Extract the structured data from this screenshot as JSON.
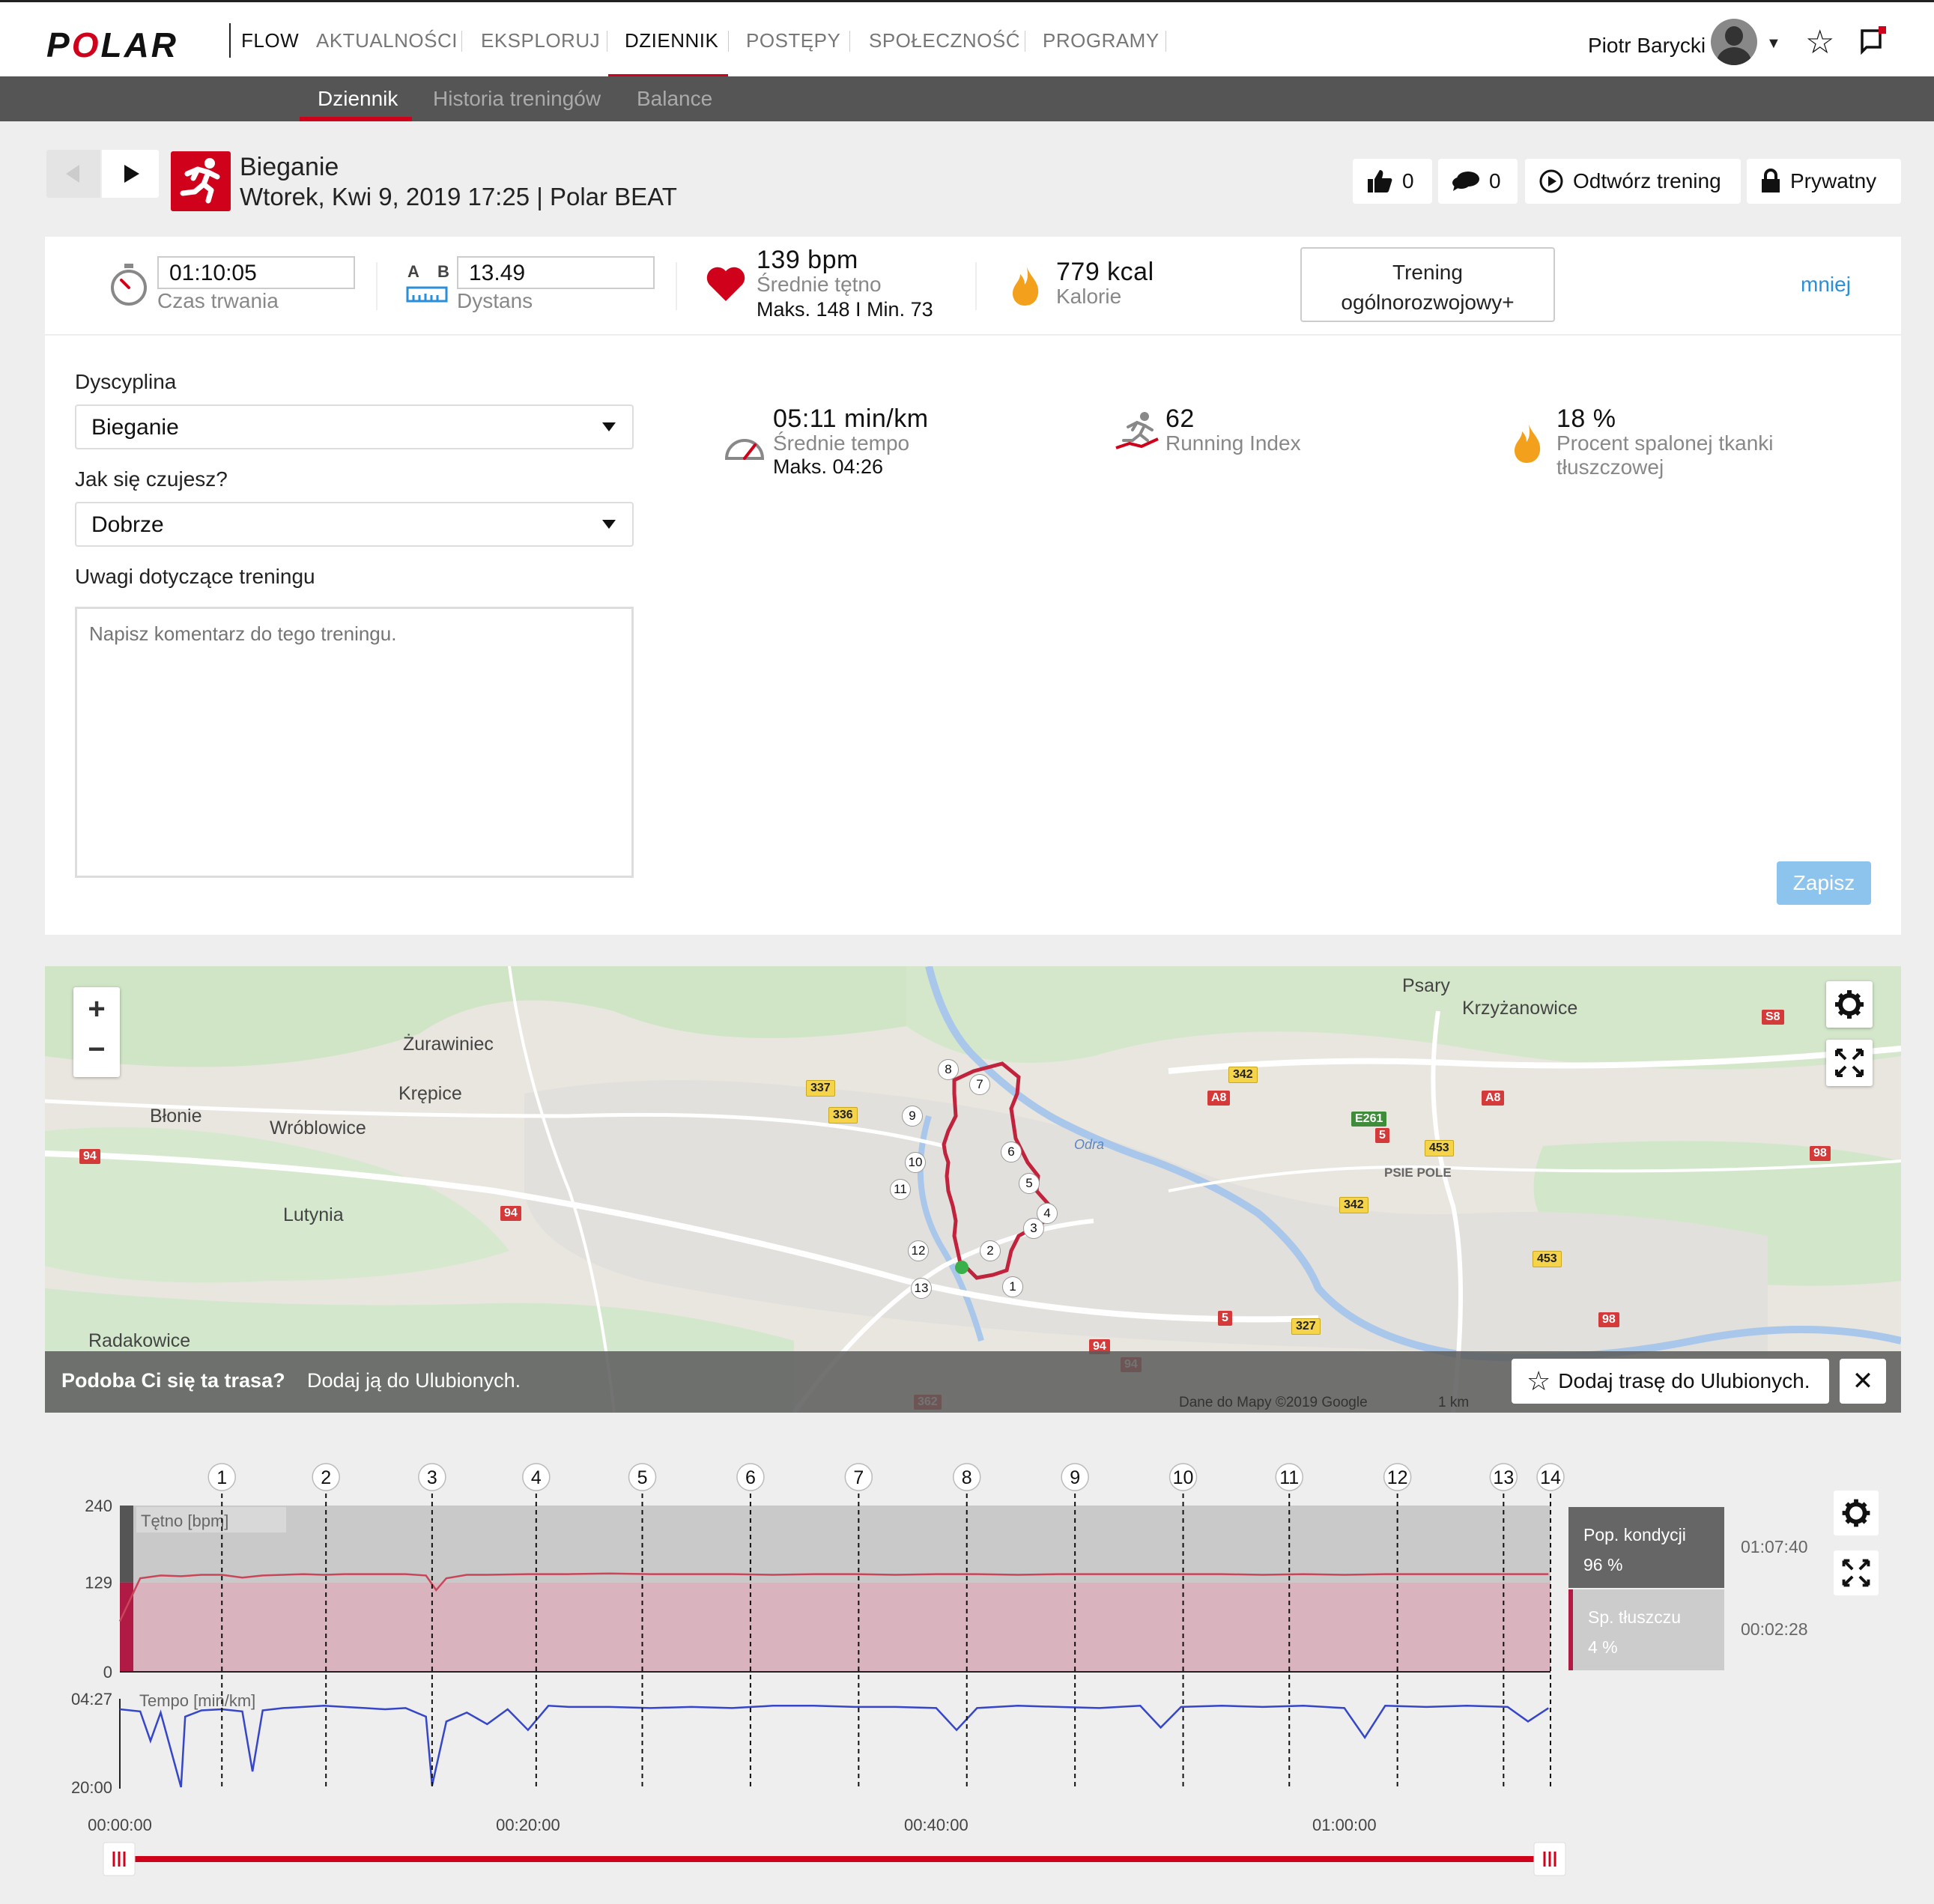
{
  "topnav": {
    "brand": "POLAR",
    "items": [
      {
        "label": "FLOW"
      },
      {
        "label": "AKTUALNOŚCI"
      },
      {
        "label": "EKSPLORUJ"
      },
      {
        "label": "DZIENNIK"
      },
      {
        "label": "POSTĘPY"
      },
      {
        "label": "SPOŁECZNOŚĆ"
      },
      {
        "label": "PROGRAMY"
      }
    ],
    "active": "DZIENNIK",
    "user_name": "Piotr Barycki"
  },
  "subnav": {
    "items": [
      {
        "label": "Dziennik"
      },
      {
        "label": "Historia treningów"
      },
      {
        "label": "Balance"
      }
    ],
    "active": "Dziennik"
  },
  "workout": {
    "sport": "Bieganie",
    "meta": "Wtorek, Kwi 9, 2019 17:25 | Polar BEAT",
    "likes": "0",
    "comments": "0",
    "replay_label": "Odtwórz trening",
    "privacy_label": "Prywatny"
  },
  "summary": {
    "duration_value": "01:10:05",
    "duration_label": "Czas trwania",
    "ab_label_a": "A",
    "ab_label_b": "B",
    "distance_value": "13.49",
    "distance_label": "Dystans",
    "hr_avg": "139 bpm",
    "hr_label": "Średnie tętno",
    "hr_maxmin": "Maks. 148  I  Min. 73",
    "calories": "779 kcal",
    "calories_label": "Kalorie",
    "training_type_line1": "Trening",
    "training_type_line2": "ogólnorozwojowy+",
    "less_link": "mniej"
  },
  "form": {
    "discipline_label": "Dyscyplina",
    "discipline_value": "Bieganie",
    "feeling_label": "Jak się czujesz?",
    "feeling_value": "Dobrze",
    "notes_label": "Uwagi dotyczące treningu",
    "notes_placeholder": "Napisz komentarz do tego treningu.",
    "save_label": "Zapisz"
  },
  "details": {
    "pace_value": "05:11 min/km",
    "pace_label": "Średnie tempo",
    "pace_max": "Maks. 04:26",
    "ri_value": "62",
    "ri_label": "Running Index",
    "fat_value": "18 %",
    "fat_label_1": "Procent spalonej tkanki",
    "fat_label_2": "tłuszczowej"
  },
  "map": {
    "places": [
      {
        "name": "Żurawiniec"
      },
      {
        "name": "Krępice"
      },
      {
        "name": "Błonie"
      },
      {
        "name": "Wróblowice"
      },
      {
        "name": "Lutynia"
      },
      {
        "name": "Radakowice"
      },
      {
        "name": "Psary"
      },
      {
        "name": "Krzyżanowice"
      },
      {
        "name": "PSIE POLE"
      },
      {
        "name": "Odra"
      }
    ],
    "road_badges": [
      "94",
      "94",
      "94",
      "94",
      "337",
      "336",
      "342",
      "A8",
      "A8",
      "E261",
      "5",
      "5",
      "453",
      "453",
      "342",
      "98",
      "98",
      "327",
      "S8",
      "362"
    ],
    "km_markers": [
      "1",
      "2",
      "3",
      "4",
      "5",
      "6",
      "7",
      "8",
      "9",
      "10",
      "11",
      "12",
      "13"
    ],
    "footer_question": "Podoba Ci się ta trasa?",
    "footer_action": "Dodaj ją do Ulubionych.",
    "fav_button": "Dodaj trasę do Ulubionych.",
    "attribution": "Dane do Mapy ©2019 Google",
    "scale": "1 km",
    "zoom_in": "+",
    "zoom_out": "−"
  },
  "chart_data": {
    "type": "line",
    "x_unit": "elapsed time",
    "x_ticks": [
      "00:00:00",
      "00:20:00",
      "00:40:00",
      "01:00:00"
    ],
    "lap_markers": [
      "1",
      "2",
      "3",
      "4",
      "5",
      "6",
      "7",
      "8",
      "9",
      "10",
      "11",
      "12",
      "13",
      "14"
    ],
    "lap_times_min": [
      5.0,
      10.1,
      15.3,
      20.4,
      25.6,
      30.9,
      36.2,
      41.5,
      46.8,
      52.1,
      57.3,
      62.6,
      67.8,
      70.1
    ],
    "heart_rate": {
      "label": "Tętno [bpm]",
      "ylim": [
        0,
        240
      ],
      "y_ticks": [
        "240",
        "129",
        "0"
      ],
      "zone_threshold": 129,
      "x": [
        0,
        1,
        2,
        3,
        4,
        5,
        6,
        7,
        8,
        9,
        10,
        11,
        12,
        13,
        14,
        15,
        15.5,
        16,
        17,
        18,
        20,
        22,
        24,
        26,
        28,
        30,
        32,
        34,
        36,
        38,
        40,
        42,
        44,
        46,
        48,
        50,
        52,
        54,
        56,
        58,
        60,
        62,
        64,
        66,
        68,
        70
      ],
      "y": [
        73,
        135,
        139,
        138,
        140,
        140,
        136,
        139,
        140,
        141,
        140,
        141,
        141,
        141,
        141,
        139,
        118,
        135,
        140,
        140,
        141,
        141,
        142,
        141,
        141,
        141,
        140,
        141,
        141,
        140,
        141,
        141,
        140,
        141,
        141,
        141,
        141,
        141,
        140,
        141,
        140,
        141,
        141,
        141,
        141,
        141
      ]
    },
    "pace": {
      "label": "Tempo [min/km]",
      "y_ticks": [
        "04:27",
        "20:00"
      ],
      "ylim_min_per_km": [
        4.45,
        20.0
      ],
      "x": [
        0,
        1,
        1.5,
        2,
        3,
        3.2,
        4,
        5,
        6,
        6.5,
        7,
        8,
        9,
        10,
        11,
        12,
        13,
        14,
        15,
        15.3,
        16,
        17,
        18,
        19,
        20,
        21,
        22,
        24,
        26,
        28,
        30,
        32,
        34,
        36,
        38,
        40,
        41,
        42,
        44,
        46,
        48,
        50,
        51,
        52,
        54,
        56,
        58,
        60,
        61,
        62,
        64,
        66,
        68,
        69,
        70
      ],
      "y": [
        5.3,
        5.5,
        9.0,
        5.6,
        19.5,
        6.0,
        5.4,
        5.3,
        5.5,
        15.0,
        5.4,
        5.2,
        5.1,
        5.0,
        5.1,
        5.2,
        5.3,
        5.2,
        6.0,
        19.0,
        6.5,
        5.6,
        6.8,
        5.3,
        7.5,
        5.0,
        5.1,
        5.1,
        5.2,
        5.1,
        5.2,
        5.0,
        5.0,
        5.1,
        5.1,
        5.2,
        7.5,
        5.2,
        5.0,
        5.1,
        5.2,
        5.0,
        7.2,
        5.1,
        5.0,
        5.1,
        5.0,
        5.2,
        8.5,
        5.0,
        5.1,
        5.0,
        5.1,
        6.5,
        5.2
      ]
    },
    "zones": [
      {
        "name": "Pop. kondycji",
        "percent": "96 %",
        "time": "01:07:40",
        "color": "#666666"
      },
      {
        "name": "Sp. tłuszczu",
        "percent": "4 %",
        "time": "00:02:28",
        "color": "#cccccc"
      }
    ]
  },
  "colors": {
    "brand_red": "#d0021b",
    "hr_line": "#c9465a",
    "hr_zone_fill": "#d9b3be",
    "pace_line": "#3546c8",
    "link_blue": "#2a8fd8"
  }
}
